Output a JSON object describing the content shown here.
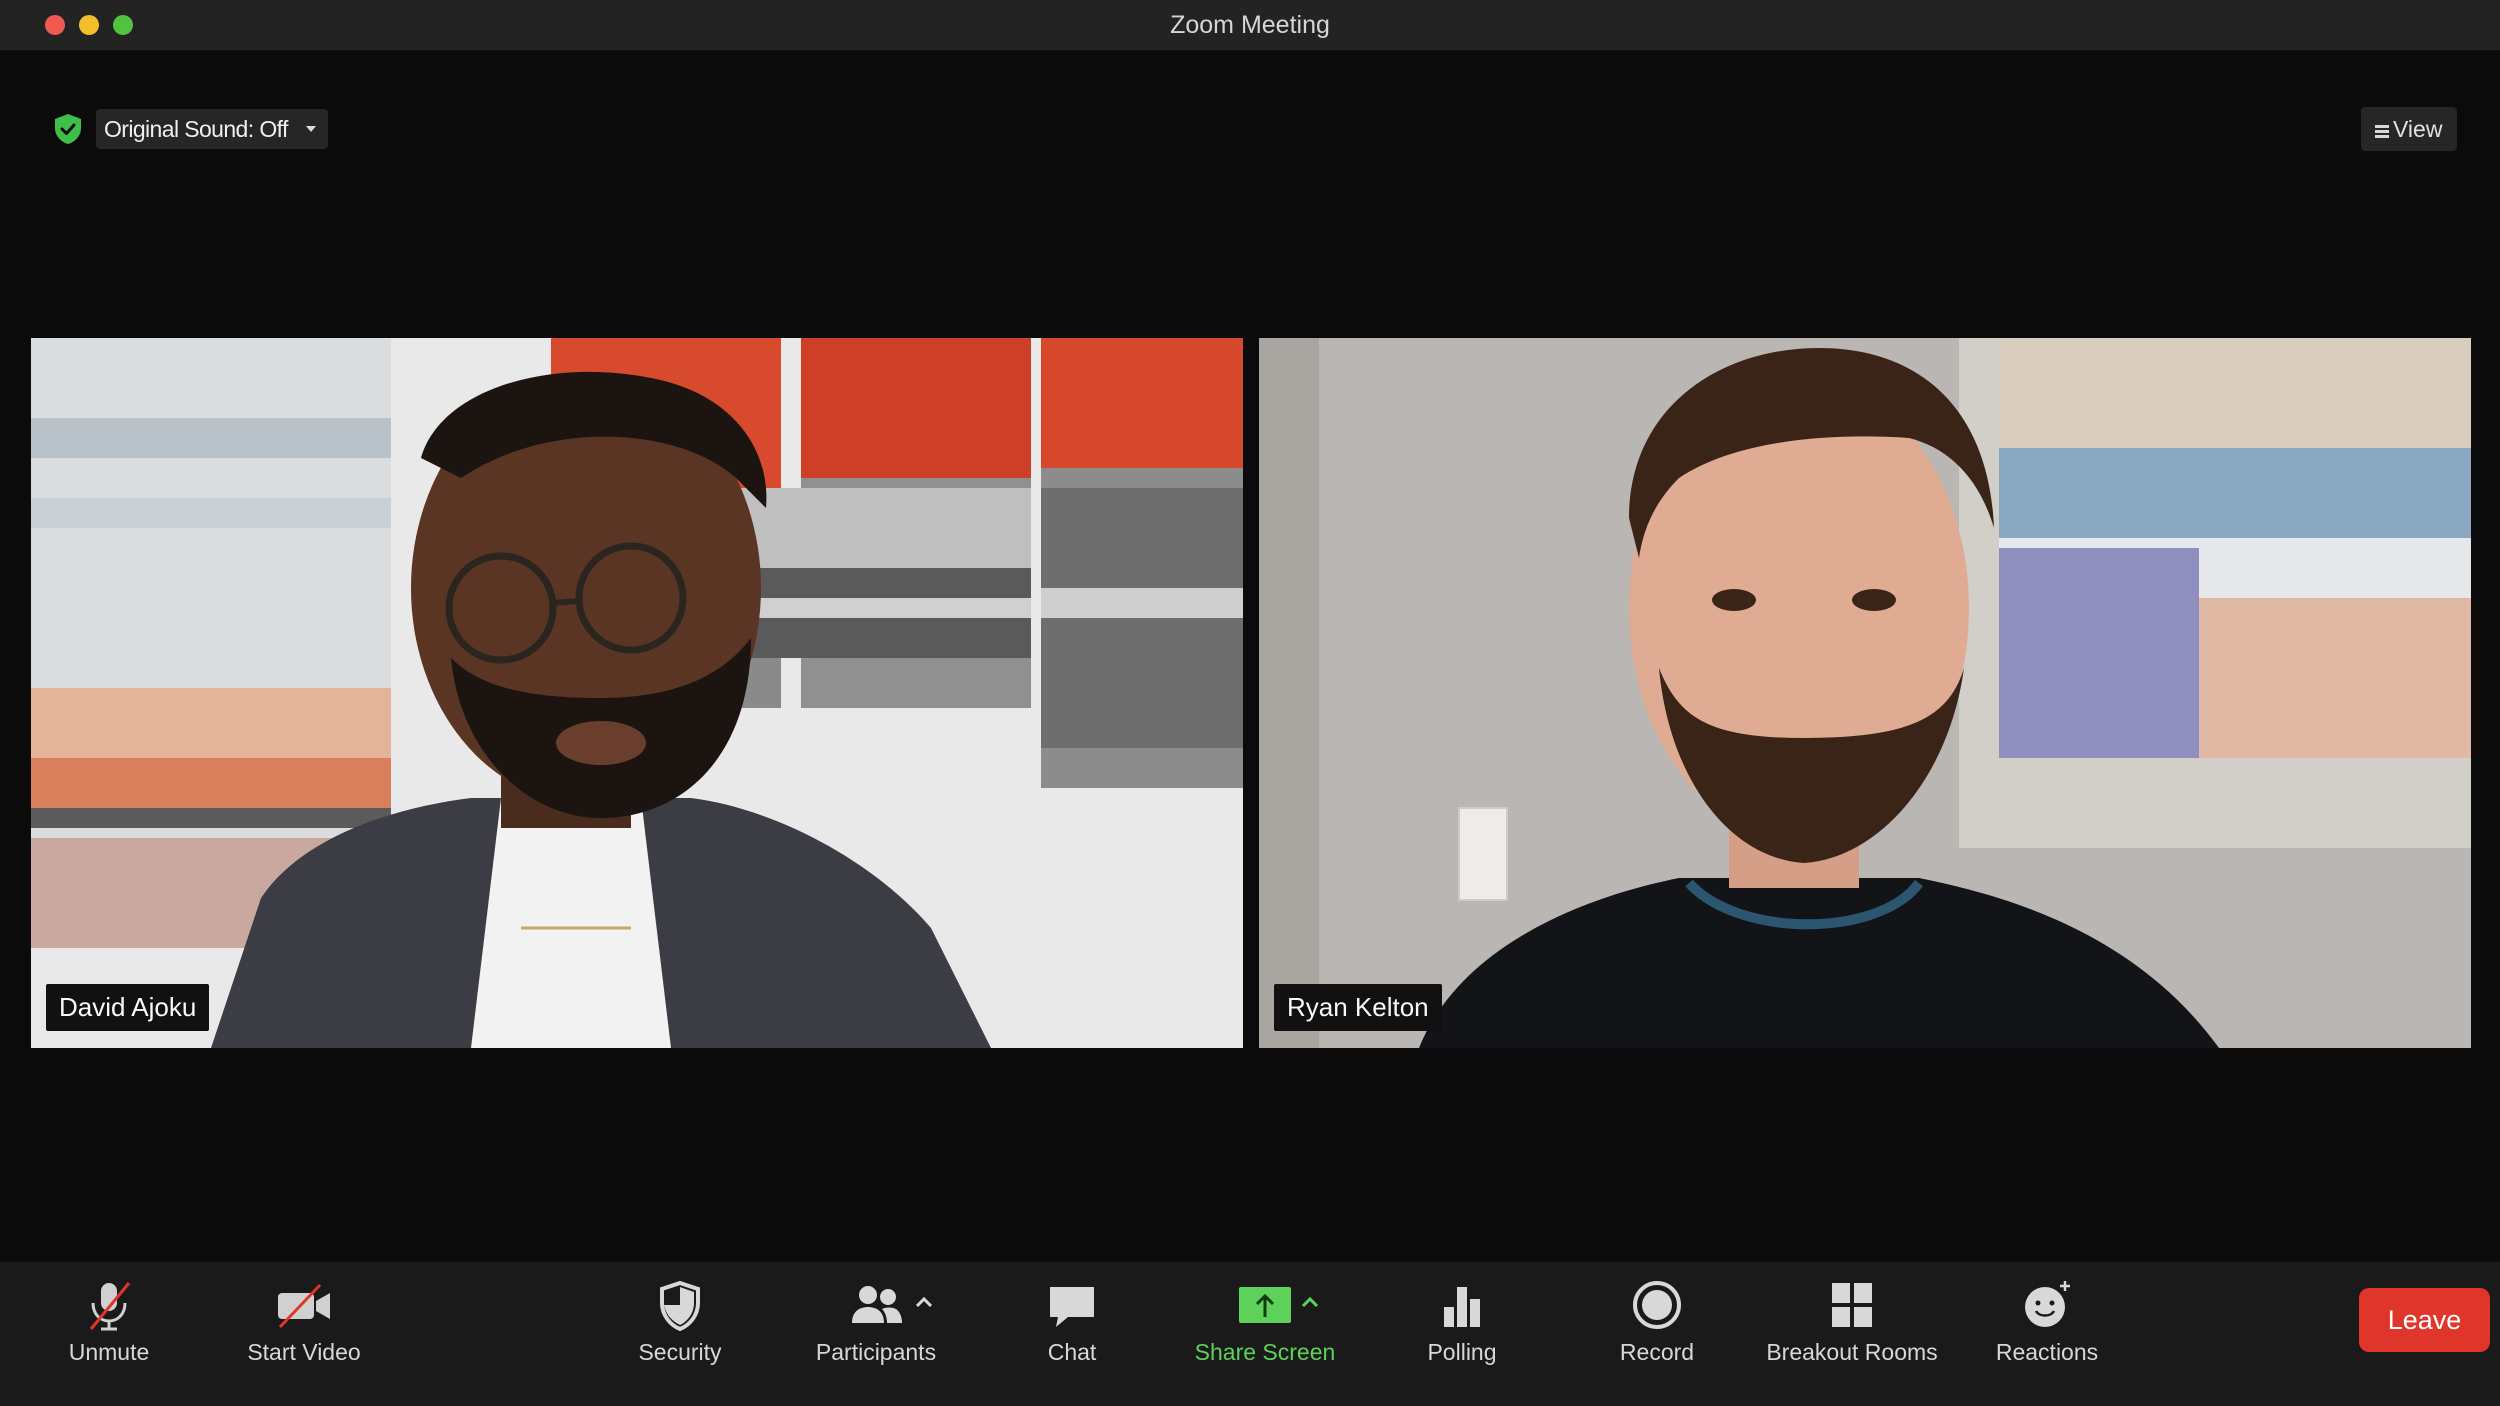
{
  "window": {
    "title": "Zoom Meeting"
  },
  "top_controls": {
    "original_sound_label": "Original Sound: Off",
    "view_label": "View",
    "security_status_color": "#3fbf4a"
  },
  "participants": [
    {
      "name": "David Ajoku",
      "video": "on"
    },
    {
      "name": "Ryan Kelton",
      "video": "on"
    }
  ],
  "toolbar": {
    "unmute": "Unmute",
    "start_video": "Start Video",
    "security": "Security",
    "participants": "Participants",
    "chat": "Chat",
    "share_screen": "Share Screen",
    "polling": "Polling",
    "record": "Record",
    "breakout_rooms": "Breakout Rooms",
    "reactions": "Reactions",
    "leave": "Leave"
  },
  "colors": {
    "share_accent": "#5ed15a",
    "leave_red": "#e0352b",
    "muted_slash_red": "#e0352b"
  }
}
